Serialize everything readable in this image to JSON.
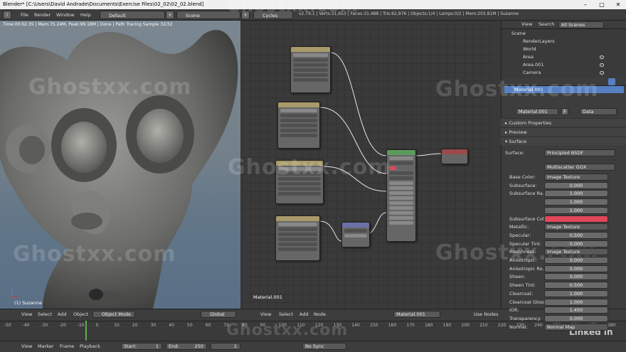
{
  "window": {
    "title": "Blender* [C:\\Users\\David Andrade\\Documents\\Exercise Files\\02_02\\02_02.blend]",
    "minimize": "–",
    "maximize": "□",
    "close": "✕"
  },
  "header": {
    "menus": [
      "File",
      "Render",
      "Window",
      "Help"
    ],
    "layout": "Default",
    "scene": "Scene",
    "engine": "Cycles Render",
    "stats": "v2.79.1 | Verts:31,653 | Faces:31,488 | Tris:62,976 | Objects:1/4 | Lamps:0/2 | Mem:203.81M | Suzanne"
  },
  "viewport": {
    "status": "Time:00:02.35 | Mem:75.24M, Peak:99.18M | Done | Path Tracing Sample 32/32",
    "object_label": "(1) Suzanne",
    "footer": {
      "menus": [
        "View",
        "Select",
        "Add",
        "Object"
      ],
      "mode": "Object Mode",
      "orientation": "Global"
    }
  },
  "node_editor": {
    "material_label": "Material.001",
    "footer": {
      "menus": [
        "View",
        "Select",
        "Add",
        "Node"
      ],
      "material": "Material.001",
      "use_nodes": "Use Nodes"
    }
  },
  "outliner": {
    "menus": [
      "View",
      "Search"
    ],
    "filter": "All Scenes",
    "items": [
      "Scene",
      "RenderLayers",
      "World",
      "Area",
      "Area.001",
      "Camera"
    ]
  },
  "properties": {
    "material_slot": "Material.001",
    "material_name": "Material.001",
    "users": "F",
    "link": "Data",
    "sections": [
      "Custom Properties",
      "Preview",
      "Surface"
    ],
    "surface": {
      "surface_label": "Surface:",
      "surface_value": "Principled BSDF",
      "distribution": "Multiscatter GGX",
      "rows": [
        {
          "label": "Base Color:",
          "value": "Image Texture",
          "kind": "link"
        },
        {
          "label": "Subsurface:",
          "value": "0.000",
          "kind": "num"
        },
        {
          "label": "Subsurface Ra...",
          "value": "1.000",
          "kind": "num"
        },
        {
          "label": "",
          "value": "1.000",
          "kind": "num"
        },
        {
          "label": "",
          "value": "1.000",
          "kind": "num"
        },
        {
          "label": "Subsurface Col",
          "value": "",
          "kind": "color"
        },
        {
          "label": "Metallic:",
          "value": "Image Texture",
          "kind": "link"
        },
        {
          "label": "Specular:",
          "value": "0.500",
          "kind": "num"
        },
        {
          "label": "Specular Tint:",
          "value": "0.000",
          "kind": "num"
        },
        {
          "label": "Roughness:",
          "value": "Image Texture",
          "kind": "link"
        },
        {
          "label": "Anisotropic:",
          "value": "0.000",
          "kind": "num"
        },
        {
          "label": "Anisotropic Ro...",
          "value": "0.000",
          "kind": "num"
        },
        {
          "label": "Sheen:",
          "value": "0.000",
          "kind": "num"
        },
        {
          "label": "Sheen Tint:",
          "value": "0.500",
          "kind": "num"
        },
        {
          "label": "Clearcoat:",
          "value": "1.000",
          "kind": "num"
        },
        {
          "label": "Clearcoat Gloss:",
          "value": "1.000",
          "kind": "num"
        },
        {
          "label": "IOR:",
          "value": "1.450",
          "kind": "num"
        },
        {
          "label": "Transparency:",
          "value": "0.000",
          "kind": "num"
        },
        {
          "label": "Normal:",
          "value": "Normal Map",
          "kind": "link"
        }
      ],
      "subsurface_color": "#e0475a"
    }
  },
  "timeline": {
    "ticks": [
      "-50",
      "-40",
      "-30",
      "-20",
      "-10",
      "0",
      "10",
      "20",
      "30",
      "40",
      "50",
      "60",
      "70",
      "80",
      "90",
      "100",
      "110",
      "120",
      "130",
      "140",
      "150",
      "160",
      "170",
      "180",
      "190",
      "200",
      "210",
      "220",
      "230",
      "240",
      "250",
      "260",
      "270",
      "280"
    ]
  },
  "playback": {
    "menus": [
      "View",
      "Marker",
      "Frame",
      "Playback"
    ],
    "start_label": "Start:",
    "start": "1",
    "end_label": "End:",
    "end": "250",
    "current": "1",
    "sync": "No Sync"
  },
  "watermarks": [
    "Ghostxx.com",
    "Ghostxx.com",
    "Ghostxx.com",
    "Ghostxx.com",
    "Ghostxx.com",
    "Ghostxx.com",
    "Ghostxx.com"
  ],
  "brand": "Linked in",
  "colors": {
    "accent": "#5680c2",
    "node_header": "#a89a6a",
    "playhead": "#5ab04a"
  }
}
